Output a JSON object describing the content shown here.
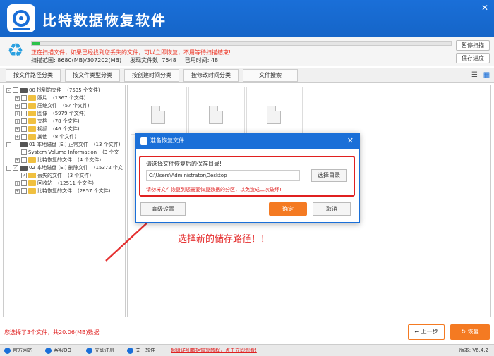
{
  "app": {
    "title": "比特数据恢复软件"
  },
  "window": {
    "minimize": "—",
    "close": "✕"
  },
  "scan": {
    "progress": 0.02,
    "message": "正在扫描文件，如果已经找到您丢失的文件，可以立即恢复，不用等待扫描结束!",
    "range": "扫描范围: 8680(MB)/307202(MB)",
    "found": "发现文件数: 7548",
    "elapsed": "已用时间: 48",
    "pause_label": "暂停扫描",
    "save_label": "保存进度"
  },
  "tabs": [
    "按文件路径分类",
    "按文件类型分类",
    "按创建时间分类",
    "按修改时间分类",
    "文件搜索"
  ],
  "tree": [
    {
      "label": "00 找到的文件",
      "count": "(7535 个文件)",
      "level": 0,
      "expander": "-",
      "checked": false,
      "icon": "drive-icon"
    },
    {
      "label": "照片",
      "count": "(1367 个文件)",
      "level": 1,
      "expander": "+",
      "checked": false,
      "icon": "folder-icon"
    },
    {
      "label": "压缩文件",
      "count": "(57 个文件)",
      "level": 1,
      "expander": "+",
      "checked": false,
      "icon": "folder-icon"
    },
    {
      "label": "图像",
      "count": "(5979 个文件)",
      "level": 1,
      "expander": "+",
      "checked": false,
      "icon": "folder-icon"
    },
    {
      "label": "文档",
      "count": "(78 个文件)",
      "level": 1,
      "expander": "+",
      "checked": false,
      "icon": "folder-icon"
    },
    {
      "label": "视频",
      "count": "(46 个文件)",
      "level": 1,
      "expander": "+",
      "checked": false,
      "icon": "folder-icon"
    },
    {
      "label": "其他",
      "count": "(8 个文件)",
      "level": 1,
      "expander": "+",
      "checked": false,
      "icon": "folder-icon"
    },
    {
      "label": "01 本地磁盘 (E:) 正常文件",
      "count": "(13 个文件)",
      "level": 0,
      "expander": "-",
      "checked": false,
      "icon": "drive-icon"
    },
    {
      "label": "System Volume Information",
      "count": "(3 个文",
      "level": 1,
      "expander": "",
      "checked": false,
      "icon": "none"
    },
    {
      "label": "比特恢复的文件",
      "count": "(4 个文件)",
      "level": 1,
      "expander": "+",
      "checked": false,
      "icon": "folder-icon"
    },
    {
      "label": "02 本地磁盘 (E:) 删除文件",
      "count": "(15372 个文",
      "level": 0,
      "expander": "-",
      "checked": true,
      "icon": "drive-icon"
    },
    {
      "label": "丢失的文件",
      "count": "(3 个文件)",
      "level": 1,
      "expander": "",
      "checked": true,
      "icon": "folder-icon"
    },
    {
      "label": "回收站",
      "count": "(12511 个文件)",
      "level": 1,
      "expander": "+",
      "checked": false,
      "icon": "folder-icon"
    },
    {
      "label": "比特恢复的文件",
      "count": "(2857 个文件)",
      "level": 1,
      "expander": "+",
      "checked": false,
      "icon": "folder-icon"
    }
  ],
  "dialog": {
    "title": "准备恢复文件",
    "close": "✕",
    "prompt": "请选择文件恢复后的保存目录!",
    "path": "C:\\Users\\Administrator\\Desktop",
    "choose_label": "选择目录",
    "warning": "请勿将文件恢复到您需要恢复数据的分区，以免造成二次破坏!",
    "advanced_label": "高级设置",
    "ok_label": "确定",
    "cancel_label": "取消"
  },
  "annotation": {
    "text": "选择新的储存路径！！",
    "color": "#e53030"
  },
  "footer": {
    "selection": "您选择了3个文件，共20.06(MB)数据",
    "prev_label": "上一步",
    "recover_label": "恢复"
  },
  "statusbar": {
    "items": [
      "官方网站",
      "客服QQ",
      "立即注册",
      "关于软件"
    ],
    "promo": "超级详细数据恢复教程，点击立即观看!",
    "version": "版本: V6.4.2"
  },
  "colors": {
    "brand": "#1a6fd8",
    "accent": "#f47a22",
    "alert": "#e02020"
  }
}
